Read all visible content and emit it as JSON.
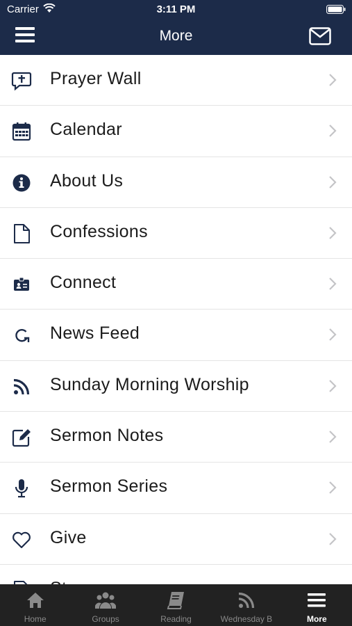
{
  "status_bar": {
    "carrier": "Carrier",
    "time": "3:11 PM"
  },
  "header": {
    "title": "More"
  },
  "menu": {
    "items": [
      {
        "label": "Prayer Wall",
        "icon": "prayer-chat-icon"
      },
      {
        "label": "Calendar",
        "icon": "calendar-icon"
      },
      {
        "label": "About Us",
        "icon": "info-icon"
      },
      {
        "label": "Confessions",
        "icon": "document-icon"
      },
      {
        "label": "Connect",
        "icon": "id-card-icon"
      },
      {
        "label": "News Feed",
        "icon": "refresh-icon"
      },
      {
        "label": "Sunday Morning Worship",
        "icon": "rss-icon"
      },
      {
        "label": "Sermon Notes",
        "icon": "edit-icon"
      },
      {
        "label": "Sermon Series",
        "icon": "microphone-icon"
      },
      {
        "label": "Give",
        "icon": "heart-icon"
      },
      {
        "label": "St",
        "icon": "document-icon"
      }
    ]
  },
  "tab_bar": {
    "tabs": [
      {
        "label": "Home",
        "icon": "home-icon",
        "active": false
      },
      {
        "label": "Groups",
        "icon": "groups-icon",
        "active": false
      },
      {
        "label": "Reading",
        "icon": "book-icon",
        "active": false
      },
      {
        "label": "Wednesday B",
        "icon": "rss-icon",
        "active": false
      },
      {
        "label": "More",
        "icon": "menu-icon",
        "active": true
      }
    ]
  },
  "colors": {
    "header_bg": "#1c2b49",
    "icon": "#1c2b49",
    "tabbar_bg": "#222222",
    "tab_active": "#ffffff",
    "tab_inactive": "#8a8a8a"
  }
}
